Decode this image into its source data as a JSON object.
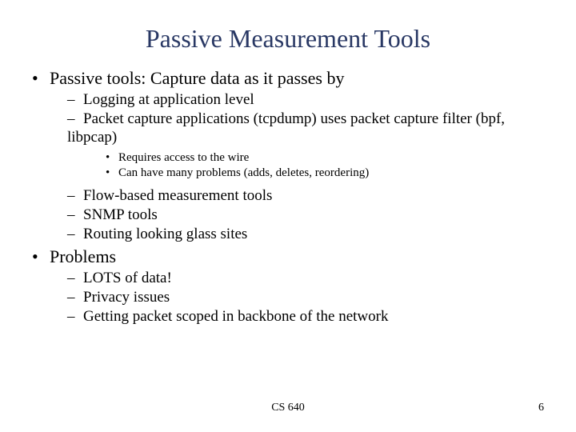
{
  "title": "Passive Measurement Tools",
  "bullets": {
    "b1": "Passive tools:  Capture data as it passes by",
    "b1_1": "Logging at application level",
    "b1_2": "Packet capture applications (tcpdump) uses packet capture filter (bpf, libpcap)",
    "b1_2_1": "Requires access to the wire",
    "b1_2_2": "Can have many problems (adds, deletes, reordering)",
    "b1_3": "Flow-based measurement tools",
    "b1_4": "SNMP tools",
    "b1_5": "Routing looking glass sites",
    "b2": "Problems",
    "b2_1": "LOTS of data!",
    "b2_2": "Privacy issues",
    "b2_3": "Getting packet scoped in backbone of the network"
  },
  "footer": {
    "center": "CS 640",
    "page": "6"
  }
}
